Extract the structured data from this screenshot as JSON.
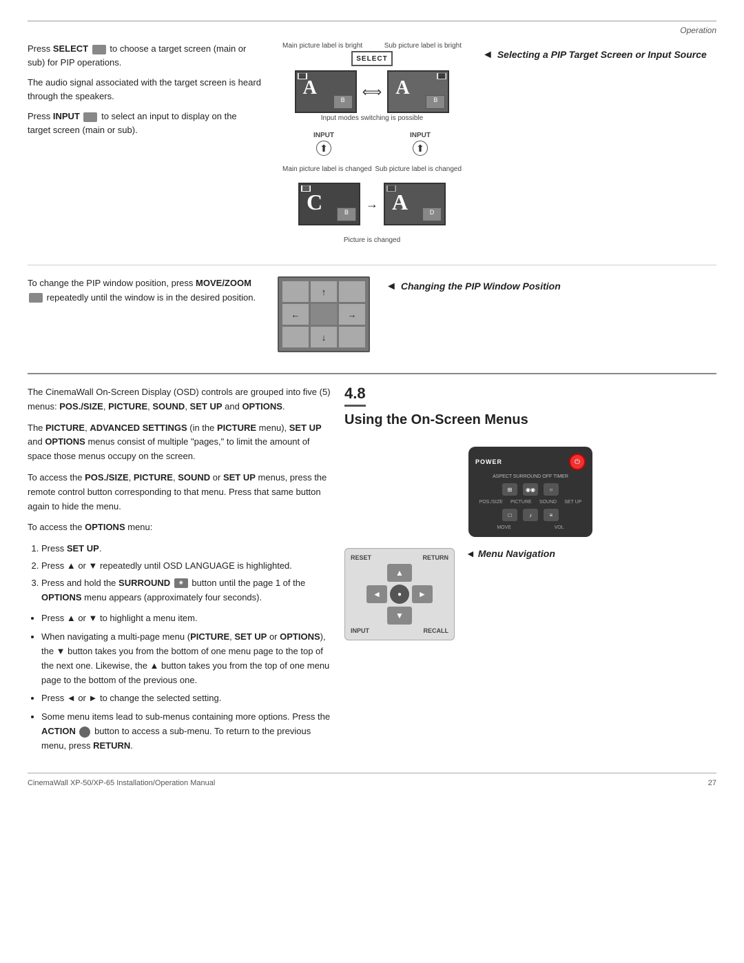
{
  "header": {
    "operation_label": "Operation"
  },
  "section_pip": {
    "heading": "Selecting a PIP Target Screen or Input Source",
    "para1": "Press SELECT  to choose a target screen (main or sub) for PIP operations.",
    "para2": "The audio signal associated with the target screen is heard through the speakers.",
    "para3": "Press INPUT  to select an input to display on the target screen (main or sub).",
    "diagram": {
      "main_label": "Main picture label is bright",
      "sub_label": "Sub picture label is bright",
      "select_text": "SELECT",
      "screen_a_letter": "A",
      "screen_b_letter": "B",
      "input_modes_note": "Input modes switching is possible",
      "input_label1": "INPUT",
      "input_label2": "INPUT",
      "main_changed": "Main picture label is changed",
      "sub_changed": "Sub picture label is changed",
      "screen_c_letter": "C",
      "screen_d_letter": "D",
      "picture_changed": "Picture is changed"
    }
  },
  "section_movezoom": {
    "heading": "Changing the PIP Window Position",
    "para": "To change the PIP window position, press MOVE/ZOOM  repeatedly until the window is in the desired position."
  },
  "section_osd": {
    "number": "4.8",
    "title": "Using the On-Screen Menus",
    "para1": "The CinemaWall On-Screen Display (OSD) controls are grouped into five (5) menus: POS./SIZE, PICTURE, SOUND, SET UP and OPTIONS.",
    "para2_bold": "PICTURE",
    "para2_rest": ", ADVANCED SETTINGS (in the PICTURE menu), SET UP and OPTIONS menus consist of multiple \"pages,\" to limit the amount of space those menus occupy on the screen.",
    "para3": "To access the POS./SIZE, PICTURE, SOUND or SET UP menus, press the remote control button corresponding to that menu. Press that same button again to hide the menu.",
    "para4": "To access the OPTIONS menu:",
    "steps": [
      "Press SET UP.",
      "Press ▲ or ▼ repeatedly until OSD LANGUAGE is highlighted.",
      "Press and hold the SURROUND  button until the page 1 of the OPTIONS menu appears (approximately four seconds)."
    ],
    "bullets": [
      "Press ▲ or ▼ to highlight a menu item.",
      "When navigating a multi-page menu (PICTURE, SET UP or OPTIONS), the ▼ button takes you from the bottom of one menu page to the top of the next one. Likewise, the ▲ button takes you from the top of one menu page to the bottom of the previous one.",
      "Press ◄ or ► to change the selected setting.",
      "Some menu items lead to sub-menus containing more options. Press the ACTION  button to access a sub-menu. To return to the previous menu, press RETURN."
    ]
  },
  "section_menu_nav": {
    "heading": "Menu Navigation",
    "remote": {
      "reset_label": "RESET",
      "return_label": "RETURN",
      "input_label": "INPUT",
      "recall_label": "RECALL"
    }
  },
  "footer": {
    "left": "CinemaWall XP-50/XP-65 Installation/Operation Manual",
    "page": "27"
  }
}
